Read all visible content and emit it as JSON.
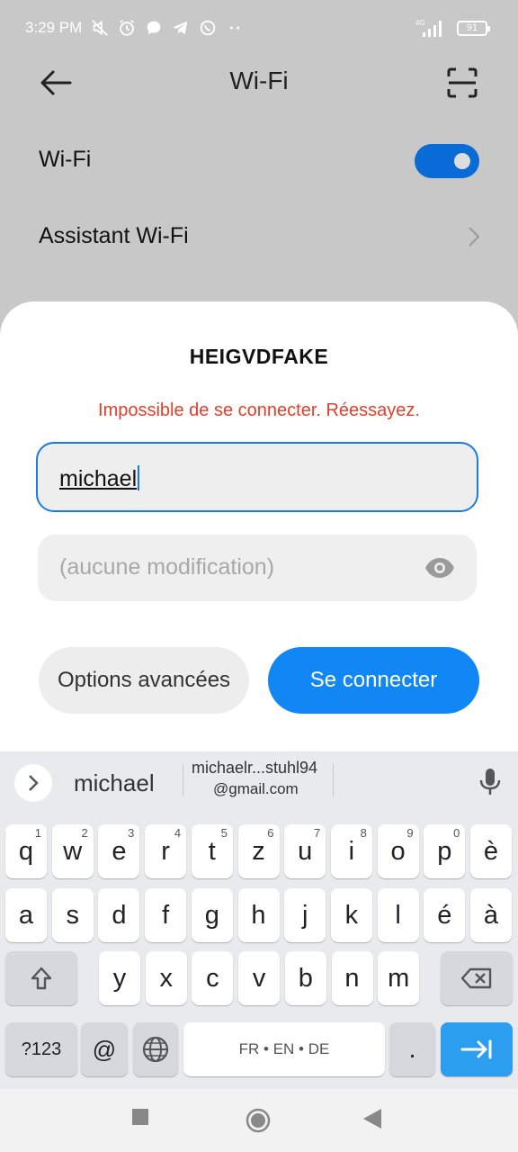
{
  "status_bar": {
    "time": "3:29 PM",
    "network": "4G",
    "battery": "91"
  },
  "app_bar": {
    "title": "Wi-Fi"
  },
  "settings": {
    "wifi_label": "Wi-Fi",
    "wifi_enabled": true,
    "assistant_label": "Assistant Wi-Fi"
  },
  "dialog": {
    "network_name": "HEIGVDFAKE",
    "error_message": "Impossible de se connecter. Réessayez.",
    "identity_value": "michael",
    "password_placeholder": "(aucune modification)",
    "advanced_label": "Options avancées",
    "connect_label": "Se connecter"
  },
  "keyboard": {
    "suggestions": [
      "michael",
      "michaelr...stuhl94",
      "@gmail.com"
    ],
    "row1": [
      {
        "k": "q",
        "h": "1"
      },
      {
        "k": "w",
        "h": "2"
      },
      {
        "k": "e",
        "h": "3"
      },
      {
        "k": "r",
        "h": "4"
      },
      {
        "k": "t",
        "h": "5"
      },
      {
        "k": "z",
        "h": "6"
      },
      {
        "k": "u",
        "h": "7"
      },
      {
        "k": "i",
        "h": "8"
      },
      {
        "k": "o",
        "h": "9"
      },
      {
        "k": "p",
        "h": "0"
      },
      {
        "k": "è",
        "h": ""
      }
    ],
    "row2": [
      "a",
      "s",
      "d",
      "f",
      "g",
      "h",
      "j",
      "k",
      "l",
      "é",
      "à"
    ],
    "row3": [
      "y",
      "x",
      "c",
      "v",
      "b",
      "n",
      "m"
    ],
    "sym_label": "?123",
    "at_label": "@",
    "space_label": "FR • EN • DE",
    "period_label": "."
  },
  "colors": {
    "accent": "#1186f5",
    "toggle": "#0a6bd6",
    "error": "#e0402a",
    "enter_key": "#2b9ef0"
  }
}
